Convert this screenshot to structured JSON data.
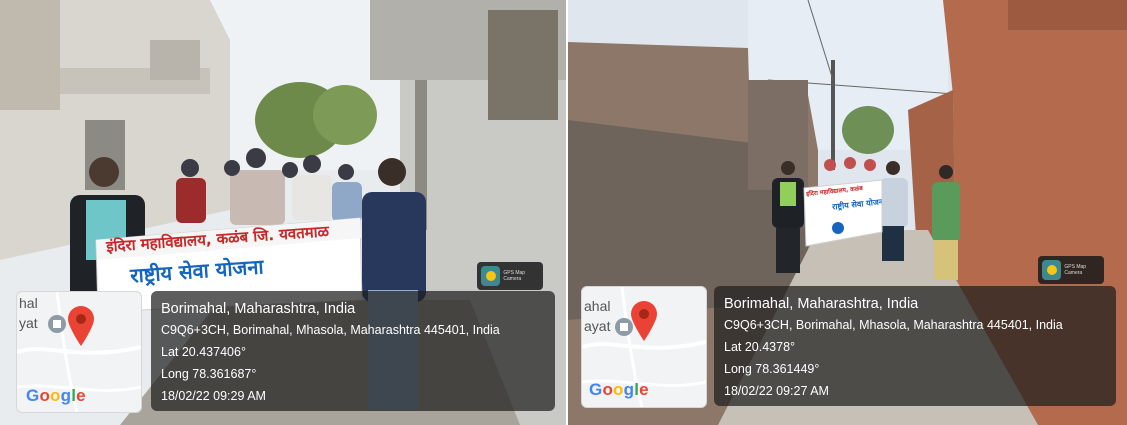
{
  "photos": [
    {
      "banner_line1": "इंदिरा महाविद्यालय, कळंब जि. यवतमाळ",
      "banner_line2": "राष्ट्रीय सेवा योजना",
      "map_place_1": "hal",
      "map_place_2": "yat",
      "google_letters": [
        "G",
        "o",
        "o",
        "g",
        "l",
        "e"
      ],
      "camera_badge": "GPS Map Camera",
      "location_title": "Borimahal, Maharashtra, India",
      "address": "C9Q6+3CH, Borimahal, Mhasola, Maharashtra 445401, India",
      "lat": "Lat 20.437406°",
      "long": "Long 78.361687°",
      "datetime": "18/02/22 09:29 AM"
    },
    {
      "banner_line1": "इंदिरा महाविद्यालय, कळंब",
      "banner_line2": "राष्ट्रीय सेवा योजना",
      "map_place_1": "ahal",
      "map_place_2": "ayat",
      "google_letters": [
        "G",
        "o",
        "o",
        "g",
        "l",
        "e"
      ],
      "camera_badge": "GPS Map Camera",
      "location_title": "Borimahal, Maharashtra, India",
      "address": "C9Q6+3CH, Borimahal, Mhasola, Maharashtra 445401, India",
      "lat": "Lat 20.4378°",
      "long": "Long 78.361449°",
      "datetime": "18/02/22 09:27 AM"
    }
  ],
  "colors": {
    "map_pin": "#EA4335",
    "card_bg": "#1e1e1e"
  }
}
